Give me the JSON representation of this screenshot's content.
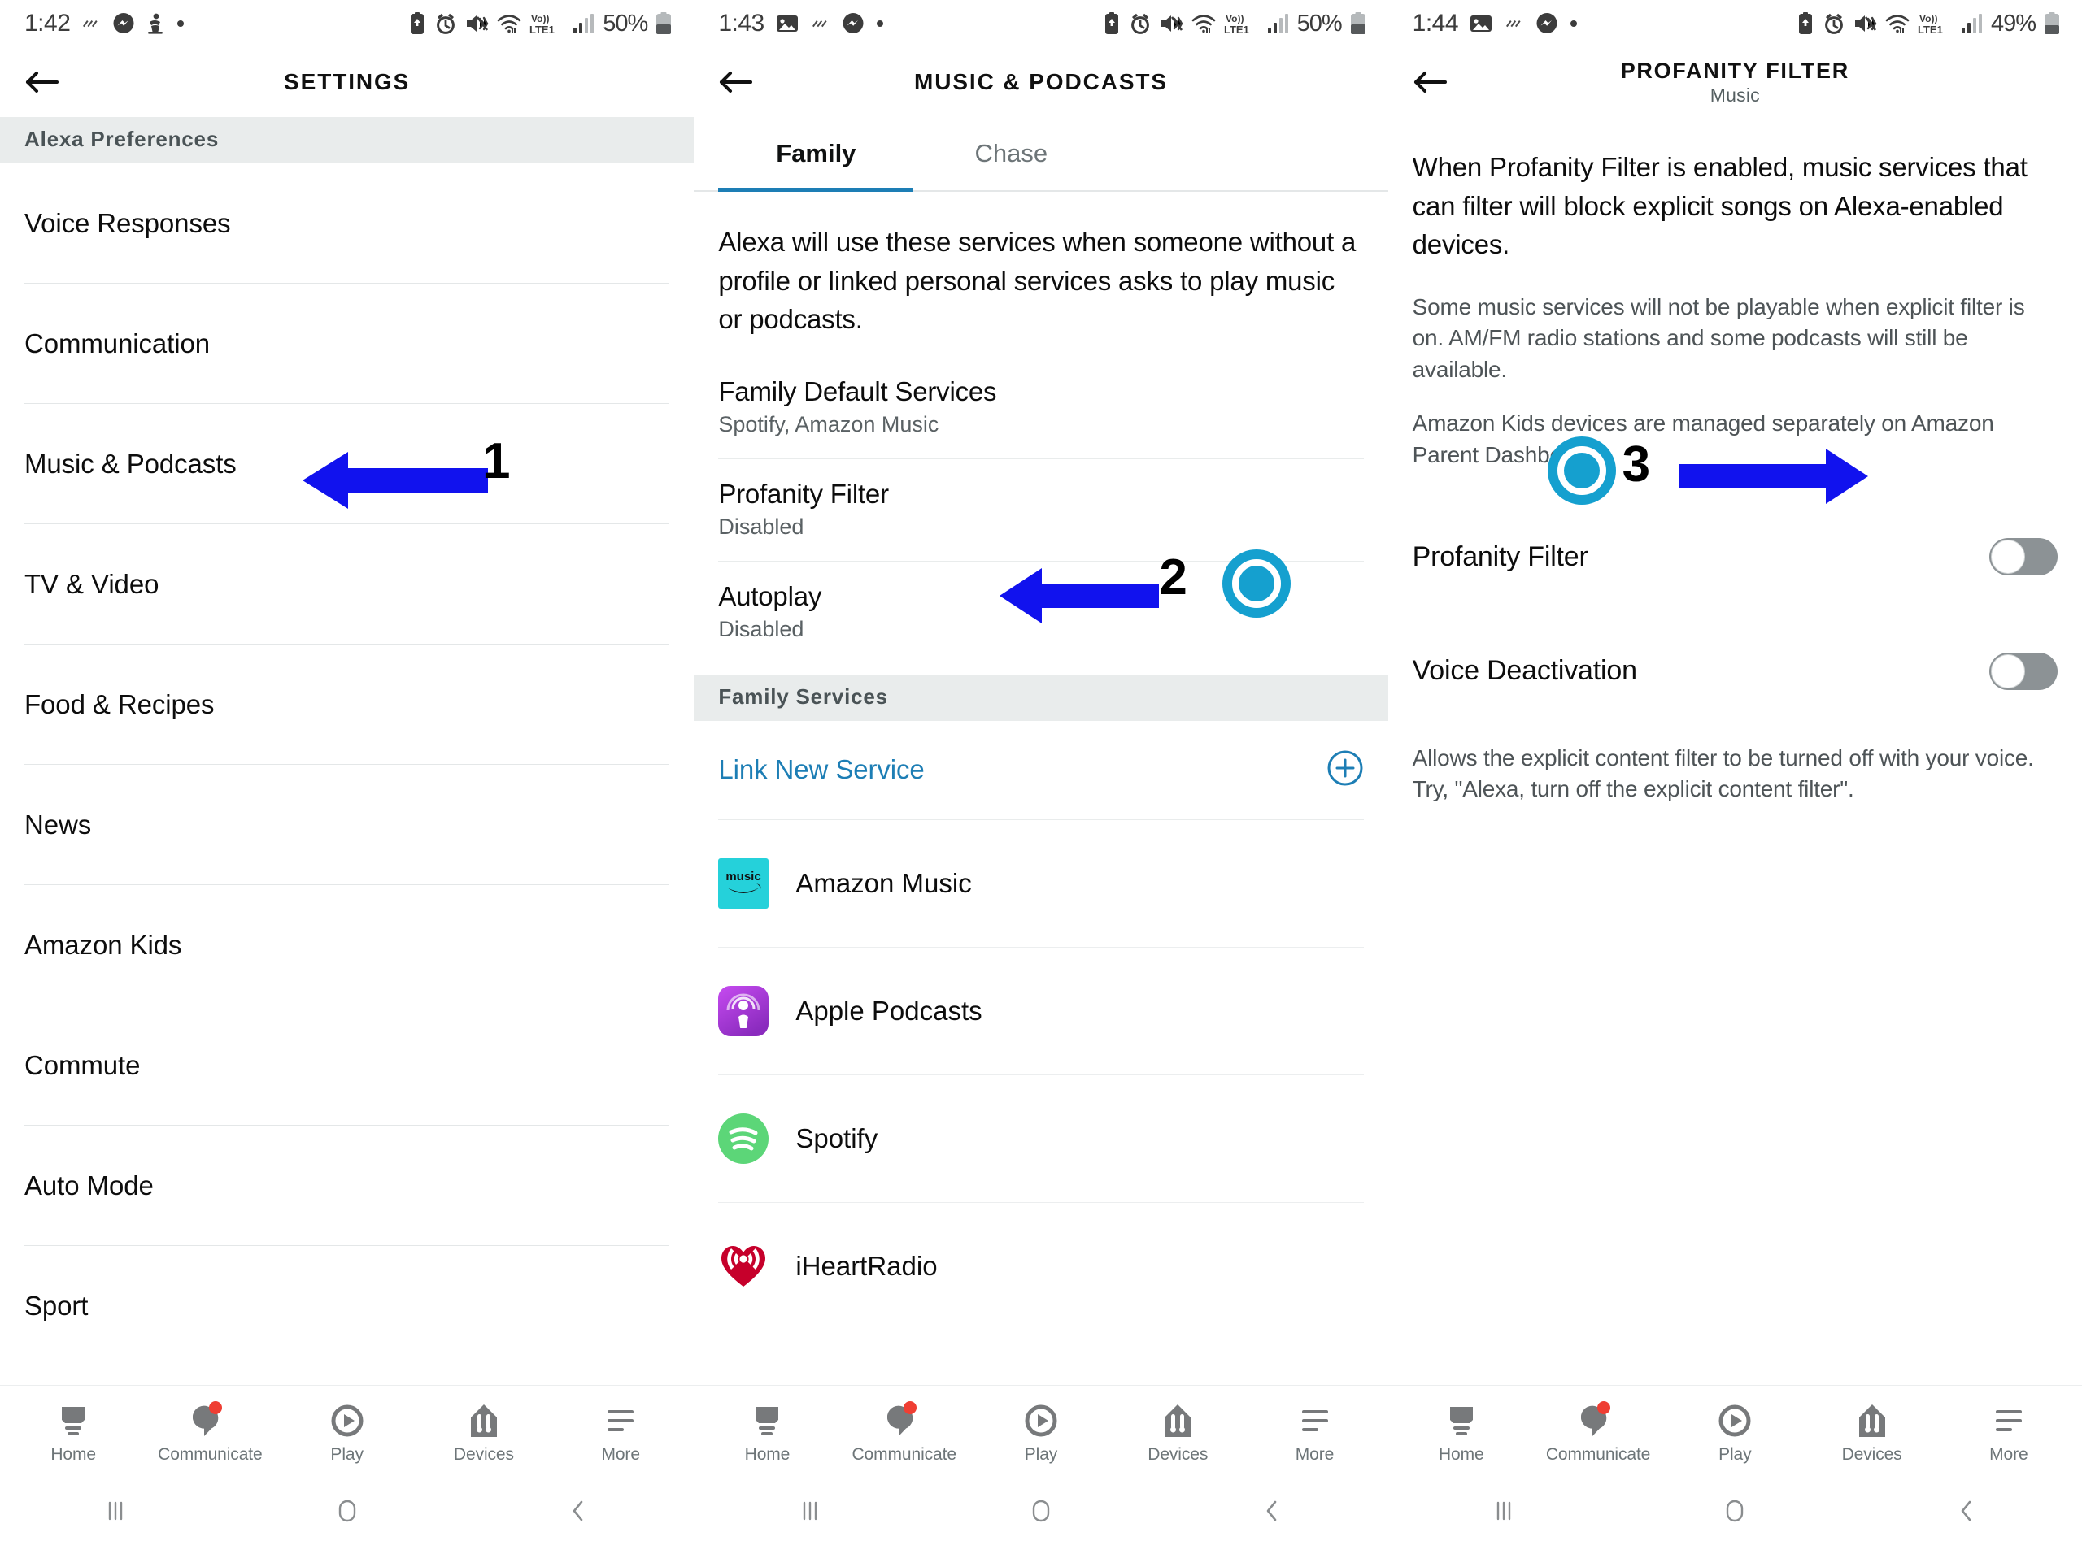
{
  "screens": [
    {
      "id": "settings",
      "statusbar": {
        "time": "1:42",
        "battery_percent": "50%",
        "left_icons": [
          "wave-icon",
          "messenger-icon",
          "app-icon",
          "dot-icon"
        ],
        "right_icons": [
          "battery-saver-icon",
          "alarm-icon",
          "mute-vibrate-icon",
          "wifi-icon",
          "volte-icon",
          "signal-bars-icon",
          "battery-icon"
        ],
        "network_label": "Vo))\nLTE1"
      },
      "header": {
        "title": "SETTINGS",
        "subtitle": "",
        "back": "back-arrow"
      },
      "section_header": "Alexa Preferences",
      "items": [
        {
          "label": "Voice Responses"
        },
        {
          "label": "Communication"
        },
        {
          "label": "Music & Podcasts"
        },
        {
          "label": "TV & Video"
        },
        {
          "label": "Food & Recipes"
        },
        {
          "label": "News"
        },
        {
          "label": "Amazon Kids"
        },
        {
          "label": "Commute"
        },
        {
          "label": "Auto Mode"
        },
        {
          "label": "Sport"
        }
      ],
      "annotation": {
        "number": "1",
        "direction": "left"
      }
    },
    {
      "id": "music-podcasts",
      "statusbar": {
        "time": "1:43",
        "battery_percent": "50%",
        "left_icons": [
          "image-icon",
          "wave-icon",
          "messenger-icon",
          "dot-icon"
        ],
        "right_icons": [
          "battery-saver-icon",
          "alarm-icon",
          "mute-vibrate-icon",
          "wifi-icon",
          "volte-icon",
          "signal-bars-icon",
          "battery-icon"
        ]
      },
      "header": {
        "title": "MUSIC & PODCASTS",
        "subtitle": "",
        "back": "back-arrow"
      },
      "tabs": [
        {
          "label": "Family",
          "active": true
        },
        {
          "label": "Chase",
          "active": false
        }
      ],
      "intro": "Alexa will use these services when someone without a profile or linked personal services asks to play music or podcasts.",
      "rows": [
        {
          "title": "Family Default Services",
          "sub": "Spotify, Amazon Music"
        },
        {
          "title": "Profanity Filter",
          "sub": "Disabled"
        },
        {
          "title": "Autoplay",
          "sub": "Disabled"
        }
      ],
      "section_header": "Family Services",
      "link_row": {
        "label": "Link New Service",
        "icon": "plus-circle-icon"
      },
      "services": [
        {
          "name": "Amazon Music",
          "icon": "amazon-music-icon",
          "color": "#25D1DA"
        },
        {
          "name": "Apple Podcasts",
          "icon": "apple-podcasts-icon",
          "color": "#9933CC"
        },
        {
          "name": "Spotify",
          "icon": "spotify-icon",
          "color": "#5CD678"
        },
        {
          "name": "iHeartRadio",
          "icon": "iheartradio-icon",
          "color": "#C6002B"
        }
      ],
      "annotation": {
        "number": "2",
        "direction": "left"
      }
    },
    {
      "id": "profanity-filter",
      "statusbar": {
        "time": "1:44",
        "battery_percent": "49%",
        "left_icons": [
          "image-icon",
          "wave-icon",
          "messenger-icon",
          "dot-icon"
        ],
        "right_icons": [
          "battery-saver-icon",
          "alarm-icon",
          "mute-vibrate-icon",
          "wifi-icon",
          "volte-icon",
          "signal-bars-icon",
          "battery-icon"
        ]
      },
      "header": {
        "title": "PROFANITY FILTER",
        "subtitle": "Music",
        "back": "back-arrow"
      },
      "paragraphs": [
        {
          "text": "When Profanity Filter is enabled, music services that can filter will block explicit songs on Alexa-enabled devices.",
          "style": "primary"
        },
        {
          "text": "Some music services will not be playable when explicit filter is on. AM/FM radio stations and some podcasts will still be available.",
          "style": "secondary"
        },
        {
          "text": "Amazon Kids devices are managed separately on Amazon Parent Dashboard",
          "style": "secondary"
        }
      ],
      "toggles": [
        {
          "label": "Profanity Filter",
          "state": "off"
        },
        {
          "label": "Voice Deactivation",
          "state": "off"
        }
      ],
      "footnote": "Allows the explicit content filter to be turned off with your voice. Try, \"Alexa, turn off the explicit content filter\".",
      "annotation": {
        "number": "3",
        "direction": "right"
      }
    }
  ],
  "bottom_nav": [
    {
      "label": "Home",
      "icon": "home-icon",
      "badge": false
    },
    {
      "label": "Communicate",
      "icon": "communicate-icon",
      "badge": true
    },
    {
      "label": "Play",
      "icon": "play-icon",
      "badge": false
    },
    {
      "label": "Devices",
      "icon": "devices-icon",
      "badge": false
    },
    {
      "label": "More",
      "icon": "more-icon",
      "badge": false
    }
  ],
  "android_nav": [
    {
      "icon": "recents-icon"
    },
    {
      "icon": "home-circle-icon"
    },
    {
      "icon": "back-chevron-icon"
    }
  ],
  "colors": {
    "accent_blue": "#1d7eb5",
    "annotation_blue": "#1112ee",
    "alexa_cyan": "#15a0cf",
    "badge_red": "#ef3e33",
    "section_bg": "#e9ecec",
    "toggle_off": "#8c9295"
  }
}
